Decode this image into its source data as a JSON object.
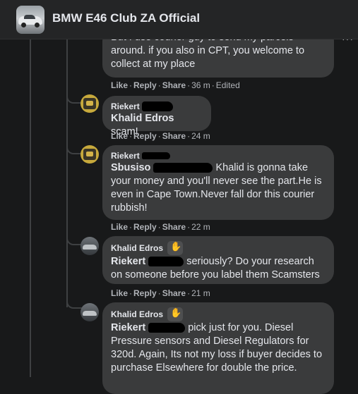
{
  "header": {
    "group_title": "BMW E46 Club ZA Official"
  },
  "comments": [
    {
      "text_partial_top": "But I use courier guy to send my parcels",
      "text_rest": "around. if you also in CPT, you welcome to collect at my place",
      "actions": {
        "like": "Like",
        "reply": "Reply",
        "share": "Share",
        "time": "36 m",
        "edited": "Edited"
      }
    },
    {
      "author": "Riekert",
      "mention": "Khalid Edros",
      "text": " scam!",
      "actions": {
        "like": "Like",
        "reply": "Reply",
        "share": "Share",
        "time": "24 m"
      }
    },
    {
      "author": "Riekert",
      "mention": "Sbusiso",
      "text": " Khalid is gonna take your money and you'll never see the part.He is even in Cape Town.Never fall dor this courier rubbish!",
      "actions": {
        "like": "Like",
        "reply": "Reply",
        "share": "Share",
        "time": "22 m"
      }
    },
    {
      "author": "Khalid Edros",
      "mention": "Riekert",
      "text": " seriously? Do your research on someone before you label them Scamsters",
      "actions": {
        "like": "Like",
        "reply": "Reply",
        "share": "Share",
        "time": "21 m"
      }
    },
    {
      "author": "Khalid Edros",
      "mention": "Riekert",
      "text": " pick just for you. Diesel Pressure sensors and Diesel Regulators for 320d. Again, Its not my loss if buyer decides to purchase Elsewhere for double the price."
    }
  ],
  "icons": {
    "more": "more-dots-icon",
    "badge": "wave-badge-icon"
  },
  "colors": {
    "background": "#18191a",
    "bubble": "#3a3b3c",
    "header": "#242526",
    "text": "#e4e6eb",
    "muted": "#b0b3b8"
  }
}
